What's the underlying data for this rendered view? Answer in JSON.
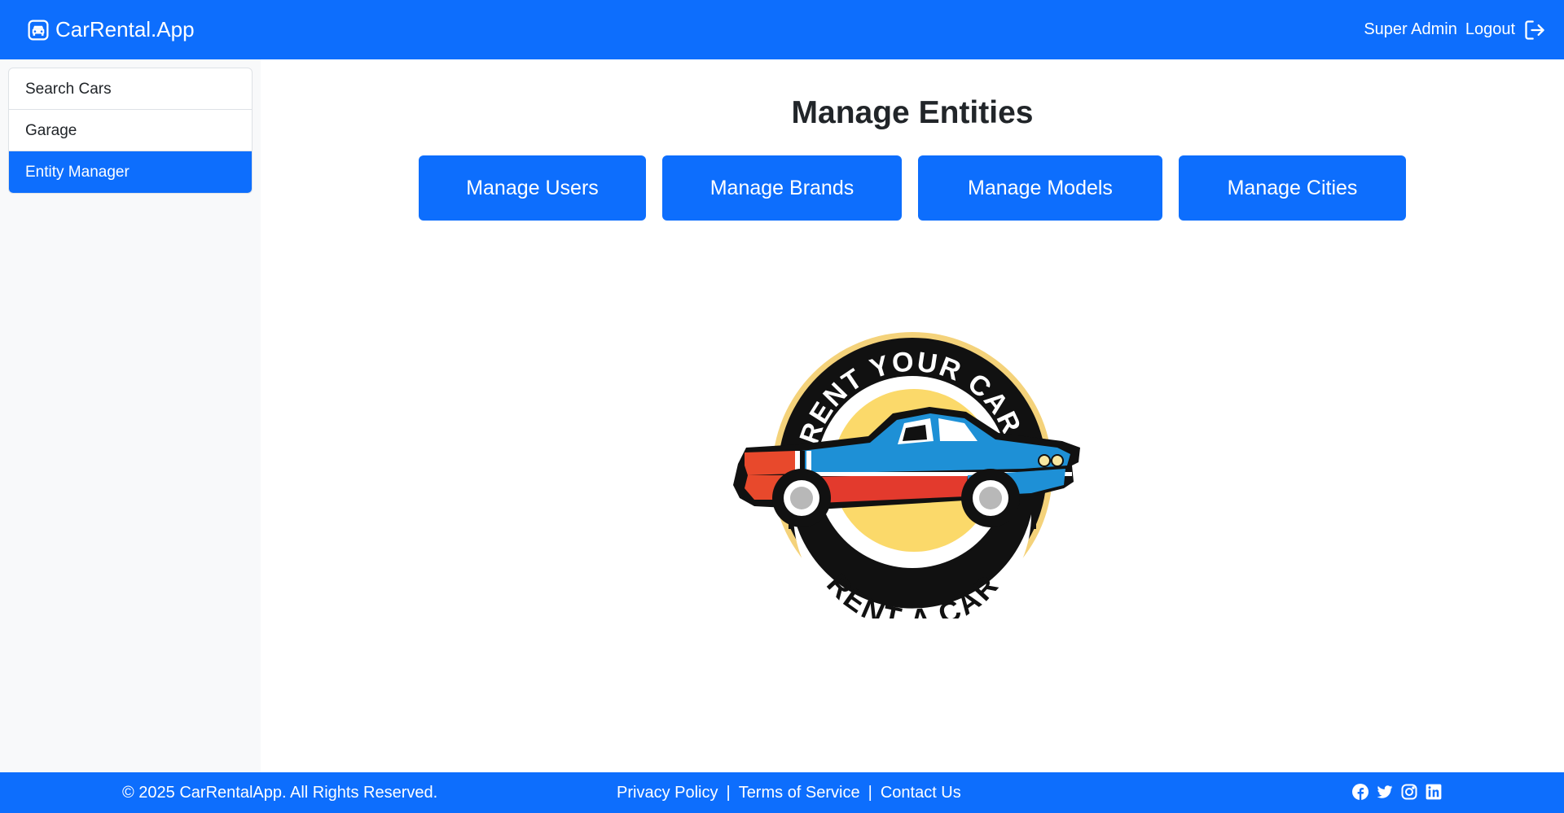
{
  "navbar": {
    "brand": "CarRental.App",
    "brand_icon": "car-icon",
    "user_name": "Super Admin",
    "logout_label": "Logout",
    "logout_icon": "box-arrow-right-icon"
  },
  "sidebar": {
    "items": [
      {
        "label": "Search Cars",
        "active": false
      },
      {
        "label": "Garage",
        "active": false
      },
      {
        "label": "Entity Manager",
        "active": true
      }
    ]
  },
  "main": {
    "title": "Manage Entities",
    "buttons": {
      "users": "Manage Users",
      "brands": "Manage Brands",
      "models": "Manage Models",
      "cities": "Manage Cities"
    },
    "logo": {
      "top_text": "RENT YOUR CAR,",
      "bottom_text": "RENT A CAR"
    }
  },
  "footer": {
    "copyright": "© 2025 CarRentalApp. All Rights Reserved.",
    "links": [
      "Privacy Policy",
      "Terms of Service",
      "Contact Us"
    ],
    "separator": "|",
    "social": [
      "facebook-icon",
      "twitter-icon",
      "instagram-icon",
      "linkedin-icon"
    ]
  },
  "colors": {
    "primary": "#0d6efd",
    "sidebar_bg": "#f8f9fa",
    "text": "#212529"
  }
}
